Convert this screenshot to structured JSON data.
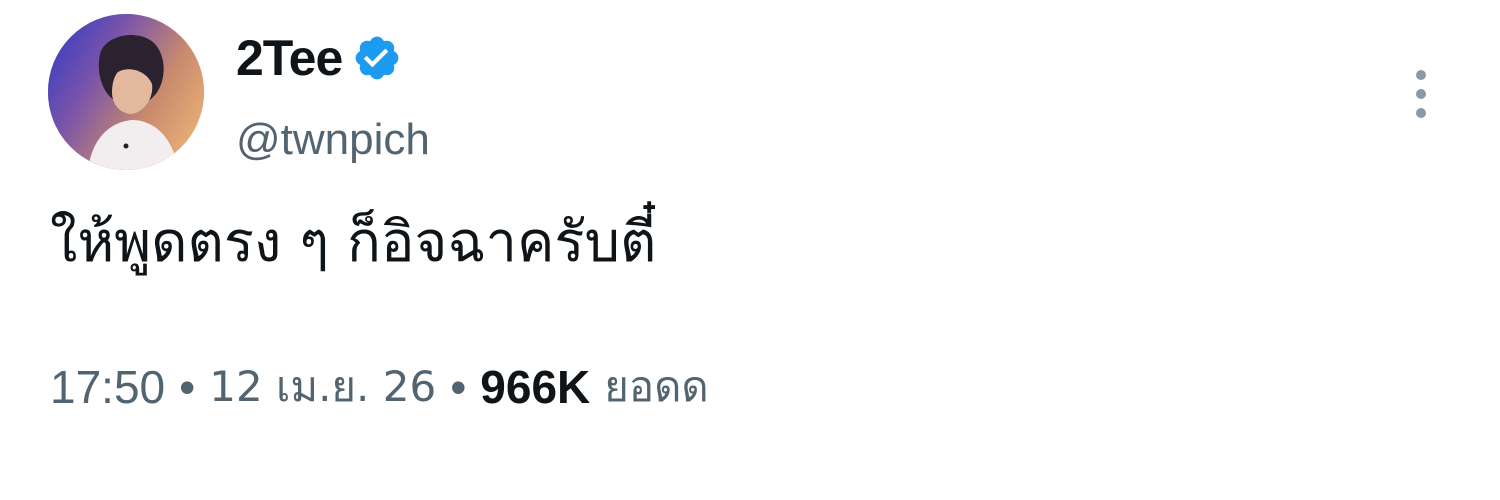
{
  "author": {
    "display_name": "2Tee",
    "handle": "@twnpich",
    "verified": true,
    "verified_color": "#1d9bf0",
    "avatar_icon": "profile-photo"
  },
  "menu": {
    "icon": "more-vertical-icon"
  },
  "tweet": {
    "text": "ให้พูดตรง ๆ ก็อิจฉาครับตี๋"
  },
  "meta": {
    "time": "17:50",
    "separator": "•",
    "date": "12 เม.ย. 26",
    "views_count": "966K",
    "views_label": "ยอดด"
  }
}
